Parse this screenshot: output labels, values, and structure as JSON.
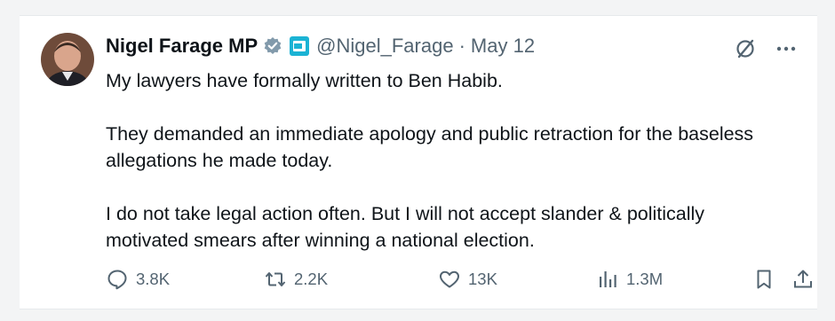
{
  "tweet": {
    "author": "Nigel Farage MP",
    "handle": "@Nigel_Farage",
    "separator": "·",
    "date": "May 12",
    "paragraphs": [
      "My lawyers have formally written to Ben Habib.",
      "They demanded an immediate apology and public retraction for the baseless allegations he made today.",
      "I do not take legal action often. But I will not accept slander & politically motivated smears after winning a national election."
    ]
  },
  "actions": {
    "replies": "3.8K",
    "reposts": "2.2K",
    "likes": "13K",
    "views": "1.3M"
  },
  "icons": {
    "verified": "verified-badge-icon",
    "affiliate": "affiliate-badge-icon",
    "grok": "grok-icon",
    "more": "more-icon",
    "reply": "reply-icon",
    "repost": "repost-icon",
    "like": "like-icon",
    "views": "views-icon",
    "bookmark": "bookmark-icon",
    "share": "share-icon"
  },
  "colors": {
    "text": "#0f1419",
    "secondary": "#536471",
    "verified": "#829aab",
    "affiliate_badge": "#1bb3d4"
  }
}
